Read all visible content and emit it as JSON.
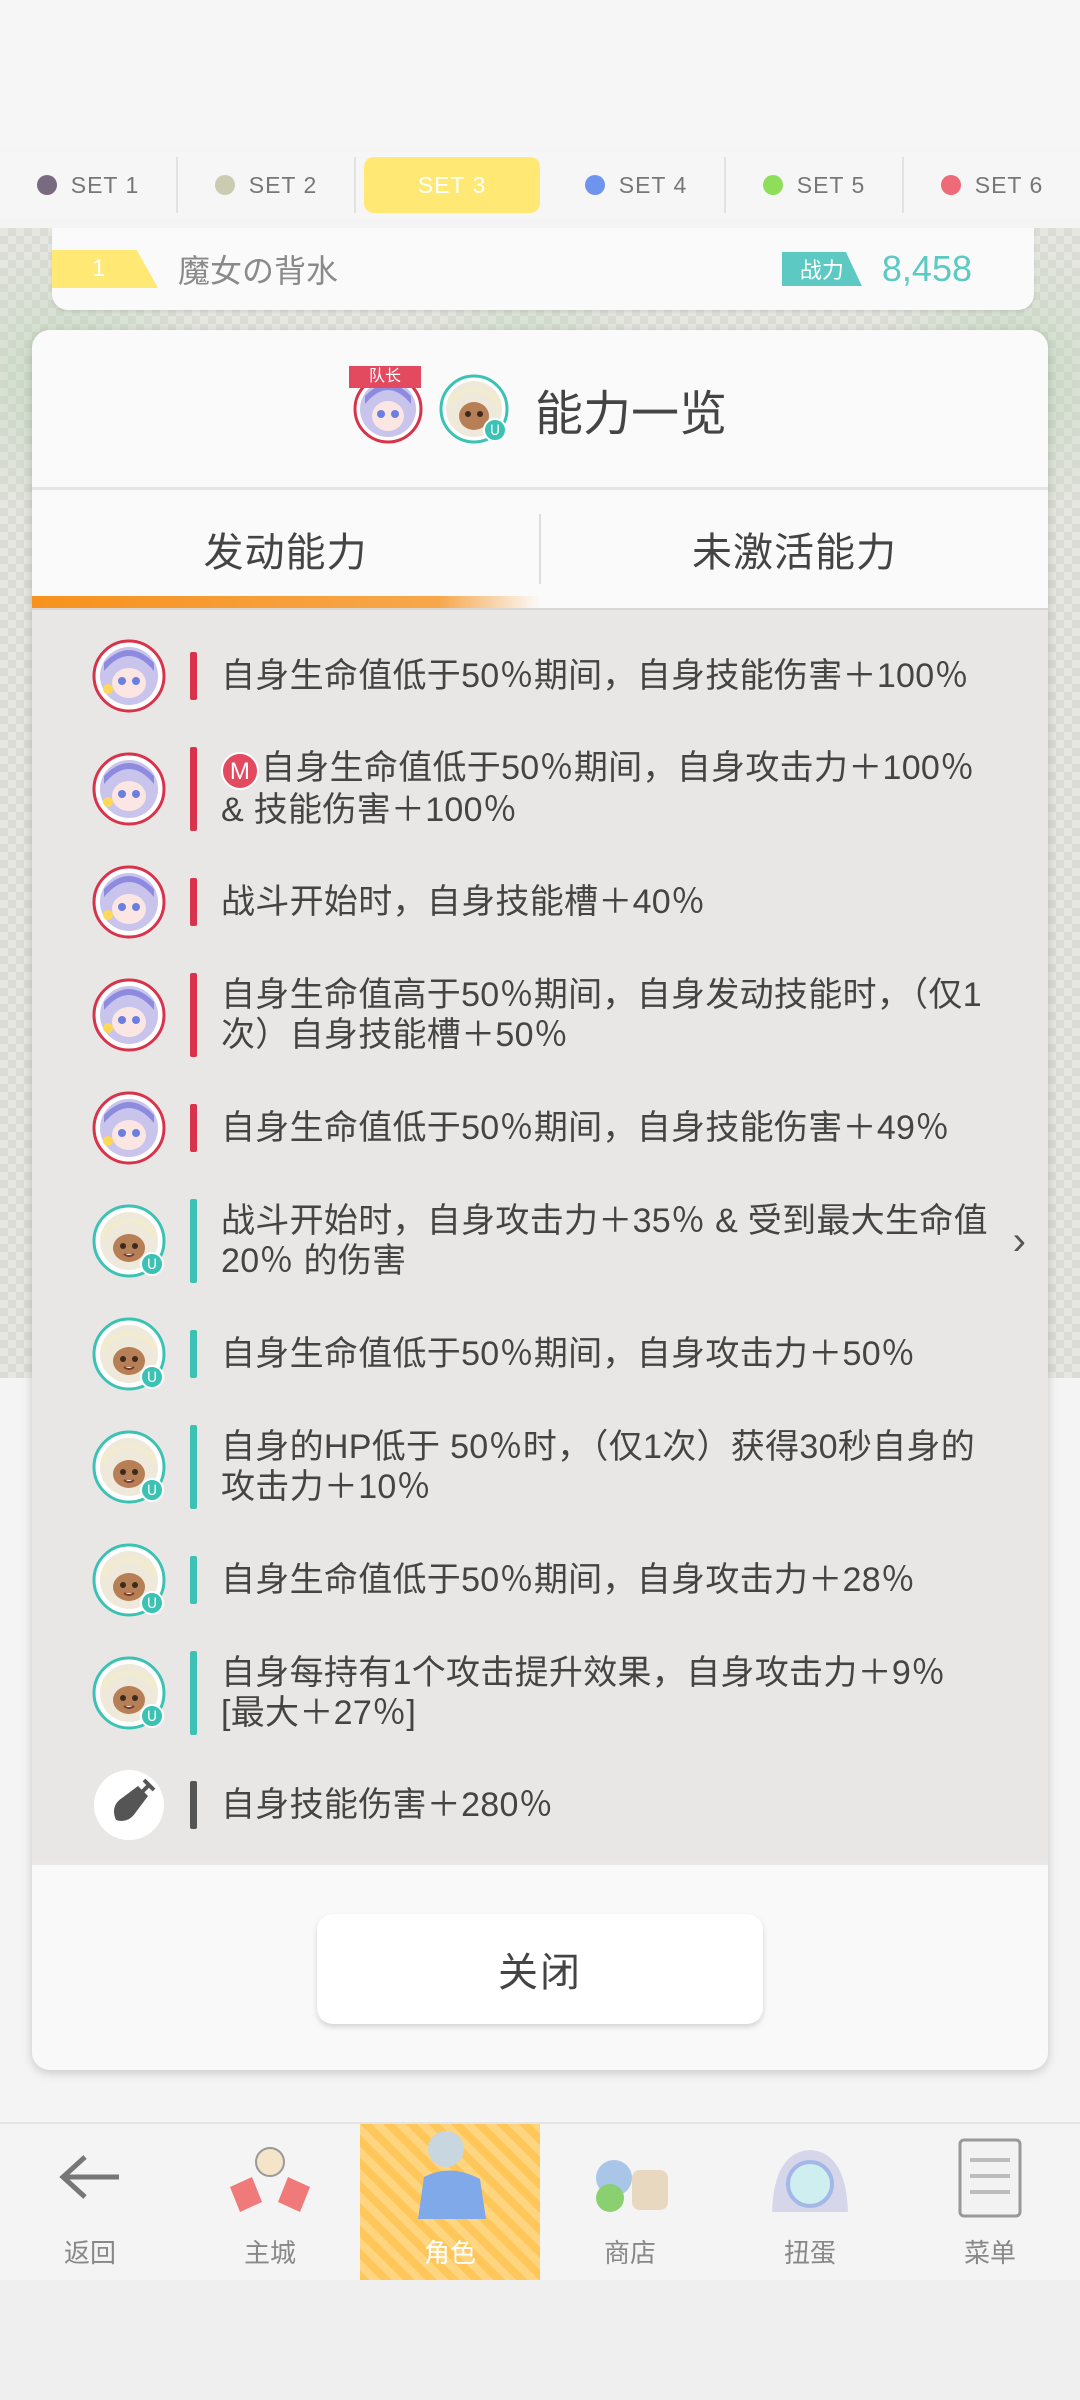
{
  "set_tabs": [
    {
      "label": "SET 1",
      "color": "#7a6a80"
    },
    {
      "label": "SET 2",
      "color": "#c9ccb0"
    },
    {
      "label": "SET 3",
      "color": "#ffe873",
      "active": true
    },
    {
      "label": "SET 4",
      "color": "#6f94ee"
    },
    {
      "label": "SET 5",
      "color": "#8ede5a"
    },
    {
      "label": "SET 6",
      "color": "#ee6a78"
    }
  ],
  "team": {
    "number": "1",
    "name": "魔女の背水",
    "power_label": "战力",
    "power": "8,458"
  },
  "modal": {
    "captain_tag": "队长",
    "title": "能力一览",
    "tabs": [
      "发动能力",
      "未激活能力"
    ],
    "abilities": [
      {
        "char": "witch",
        "bar": "#d8334a",
        "text": "自身生命值低于50％期间，自身技能伤害＋100％"
      },
      {
        "char": "witch",
        "bar": "#d8334a",
        "badge": "M",
        "text": "自身生命值低于50％期间，自身攻击力＋100％ & 技能伤害＋100％"
      },
      {
        "char": "witch",
        "bar": "#d8334a",
        "text": "战斗开始时，自身技能槽＋40％"
      },
      {
        "char": "witch",
        "bar": "#d8334a",
        "text": "自身生命值高于50％期间，自身发动技能时，（仅1次）自身技能槽＋50％"
      },
      {
        "char": "witch",
        "bar": "#d8334a",
        "text": "自身生命值低于50％期间，自身技能伤害＋49％"
      },
      {
        "char": "girl",
        "bar": "#3cc2b4",
        "text": "战斗开始时，自身攻击力＋35％ & 受到最大生命值 20％ 的伤害",
        "chevron": "›"
      },
      {
        "char": "girl",
        "bar": "#3cc2b4",
        "text": "自身生命值低于50％期间，自身攻击力＋50％"
      },
      {
        "char": "girl",
        "bar": "#3cc2b4",
        "text": "自身的HP低于 50％时，（仅1次）获得30秒自身的攻击力＋10％"
      },
      {
        "char": "girl",
        "bar": "#3cc2b4",
        "text": "自身生命值低于50％期间，自身攻击力＋28％"
      },
      {
        "char": "girl",
        "bar": "#3cc2b4",
        "text": "自身每持有1个攻击提升效果，自身攻击力＋9％[最大＋27％]"
      },
      {
        "char": "weapon",
        "bar": "#555555",
        "text": "自身技能伤害＋280％"
      }
    ],
    "close_label": "关闭"
  },
  "bottom_nav": [
    {
      "label": "返回",
      "icon": "back-arrow-icon"
    },
    {
      "label": "主城",
      "icon": "castle-icon"
    },
    {
      "label": "角色",
      "icon": "character-icon",
      "active": true
    },
    {
      "label": "商店",
      "icon": "shop-icon"
    },
    {
      "label": "扭蛋",
      "icon": "gacha-icon"
    },
    {
      "label": "菜单",
      "icon": "menu-icon"
    }
  ]
}
